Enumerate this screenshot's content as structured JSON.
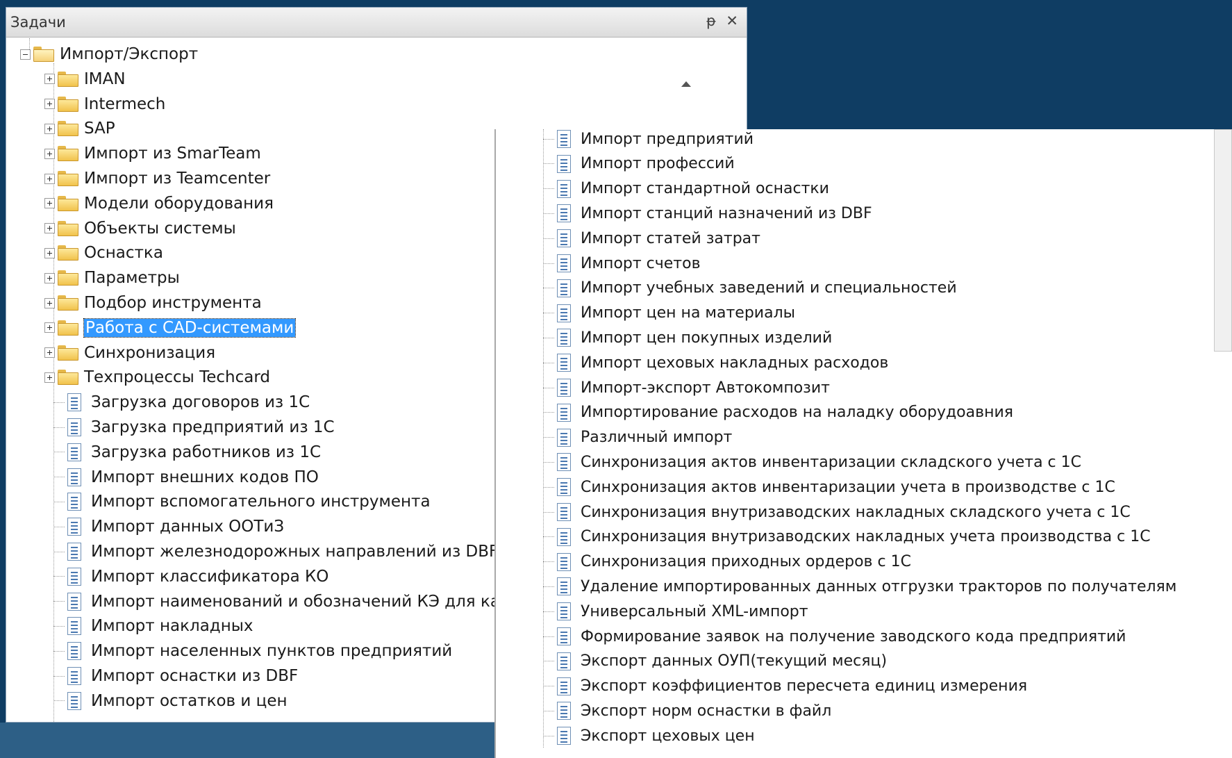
{
  "window": {
    "title": "Задачи",
    "pin_glyph": "ᵖ",
    "close_glyph": "✕"
  },
  "tree": {
    "root": "Импорт/Экспорт",
    "folders": [
      "IMAN",
      "Intermech",
      "SAP",
      "Импорт из SmarTeam",
      "Импорт из Teamcenter",
      "Модели оборудования",
      "Объекты системы",
      "Оснастка",
      "Параметры",
      "Подбор инструмента",
      "Работа с CAD-системами",
      "Синхронизация",
      "Техпроцессы Techcard"
    ],
    "selected_folder": "Работа с CAD-системами",
    "items_left": [
      "Загрузка договоров из 1С",
      "Загрузка предприятий из 1С",
      "Загрузка работников из 1С",
      "Импорт внешних кодов ПО",
      "Импорт вспомогательного инструмента",
      "Импорт данных ООТиЗ",
      "Импорт железнодорожных направлений из DBF",
      "Импорт классификатора КО",
      "Импорт наименований и обозначений КЭ для катал",
      "Импорт накладных",
      "Импорт населенных пунктов предприятий",
      "Импорт оснастки из DBF",
      "Импорт остатков и цен"
    ],
    "items_right": [
      "Импорт предприятий",
      "Импорт профессий",
      "Импорт стандартной оснастки",
      "Импорт станций назначений из DBF",
      "Импорт статей затрат",
      "Импорт счетов",
      "Импорт учебных заведений и специальностей",
      "Импорт цен на материалы",
      "Импорт цен покупных изделий",
      "Импорт цеховых накладных расходов",
      "Импорт-экспорт Автокомпозит",
      "Импортирование расходов на наладку оборудоавния",
      "Различный импорт",
      "Синхронизация актов инвентаризации складского учета с 1С",
      "Синхронизация актов инвентаризации учета в производстве с 1С",
      "Синхронизация внутризаводских накладных складского учета с 1С",
      "Синхронизация внутризаводских накладных учета производства с 1С",
      "Синхронизация приходных ордеров с 1С",
      "Удаление импортированных данных отгрузки тракторов по получателям",
      "Универсальный XML-импорт",
      "Формирование заявок на получение заводского кода предприятий",
      "Экспорт данных ОУП(текущий месяц)",
      "Экспорт коэффициентов пересчета единиц измерения",
      "Экспорт норм оснастки в файл",
      "Экспорт цеховых цен"
    ]
  }
}
